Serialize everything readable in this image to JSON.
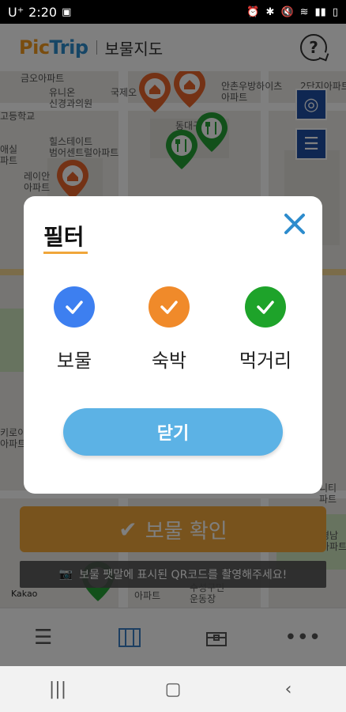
{
  "status_bar": {
    "carrier": "U⁺",
    "time": "2:20"
  },
  "header": {
    "logo_pic": "Pic",
    "logo_trip": "Trip",
    "title": "보물지도",
    "help_glyph": "?"
  },
  "map": {
    "labels": [
      {
        "text": "금오아파트"
      },
      {
        "text": "유니온\n신경과의원"
      },
      {
        "text": "국제오"
      },
      {
        "text": "안촌우방하이츠\n아파트"
      },
      {
        "text": "2단지아파트"
      },
      {
        "text": "동대구제"
      },
      {
        "text": "고등학교"
      },
      {
        "text": "힐스테이트\n범어센트럴아파트"
      },
      {
        "text": "애실\n파트"
      },
      {
        "text": "레이안\n아파트"
      },
      {
        "text": "키로이\n아파트"
      },
      {
        "text": "니티\n파트"
      },
      {
        "text": "아파트"
      },
      {
        "text": "수성구민\n운동장"
      },
      {
        "text": "경남\n아파트"
      }
    ],
    "kakao_text": "Kakao"
  },
  "confirm_button": {
    "label": "보물 확인"
  },
  "qr_hint": {
    "text": "보물 팻말에 표시된 QR코드를 촬영해주세요!"
  },
  "dialog": {
    "title": "필터",
    "options": [
      {
        "label": "보물",
        "color": "#3d7ff0"
      },
      {
        "label": "숙박",
        "color": "#f08a2a"
      },
      {
        "label": "먹거리",
        "color": "#1ea32a"
      }
    ],
    "close_button": "닫기",
    "close_icon_color": "#2d8ccd"
  },
  "colors": {
    "accent_orange": "#f0a63a",
    "pin_orange": "#e8652a",
    "pin_green": "#24a035",
    "map_control_blue": "#1f4ea5"
  }
}
